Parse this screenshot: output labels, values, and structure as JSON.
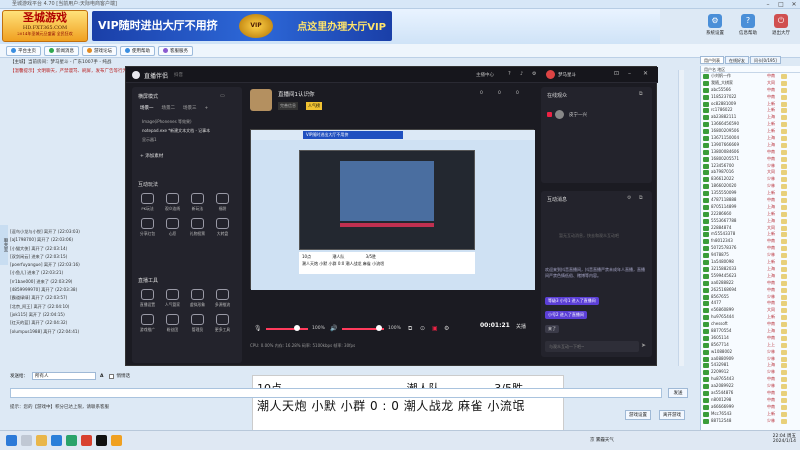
{
  "window": {
    "title": "圣城游戏平台 4.70 [当前用户:天际电商客户端]",
    "controls": [
      "–",
      "□",
      "✕"
    ]
  },
  "banner": {
    "logo_line1": "圣城游戏",
    "logo_line2": "HD.FXT365.COM",
    "logo_line3": "2014年圣城元旦盛宴 全民狂欢",
    "ad_left": "VIP随时进出大厅不用挤",
    "ad_badge": "VIP",
    "ad_right": "点这里办理大厅VIP",
    "buttons": [
      {
        "label": "系统设置",
        "icon": "gear-icon"
      },
      {
        "label": "信息帮助",
        "icon": "help-icon"
      },
      {
        "label": "官方通道",
        "icon": "home-icon"
      },
      {
        "label": "退出大厅",
        "icon": "logout-icon"
      }
    ]
  },
  "toolbar": {
    "buttons": [
      "平台主页",
      "新闻消息",
      "游戏论坛",
      "使用帮助",
      "客服服务"
    ],
    "right_buttons": [
      "用户列表",
      "在线好友"
    ]
  },
  "chat": {
    "header": "【主城】当前房间：梦马星斗 - 广东1007手 - 纯战",
    "notice": "【温馨提示】文明聊天，严禁谩骂、刷屏，发布广告等行为，违者将被封号处理。",
    "side_tab": "聊天室",
    "lines": [
      "[逗鸟小龙与小悦] 离开了 (22:03:03)",
      "[aJ1798700] 离开了 (22:03:06)",
      "[小猫大侠] 离开了 (22:03:14)",
      "[双剑闲云] 进来了 (22:03:15)",
      "[poerfuyangue] 离开了 (22:03:16)",
      "[小鱼儿] 进来了 (22:03:21)",
      "[rr1bae000] 进来了 (22:03:29)",
      "[4859999970] 离开了 (22:03:38)",
      "[霸道绿绿] 离开了 (22:03:57)",
      "[北京_阿王] 离开了 (22:04:10)",
      "[jok115] 离开了 (22:04:15)",
      "[红天的蓝] 离开了 (22:04:32)",
      "[olumpus1988] 离开了 (22:04:41)"
    ]
  },
  "userlist": {
    "tabs": [
      "用户列表",
      "在线好友",
      "问卡[0/195]"
    ],
    "header": "用户名         地区",
    "rows": [
      {
        "name": "小刘帆一作",
        "region": "中南"
      },
      {
        "name": "我随_大棋家",
        "region": "大同"
      },
      {
        "name": "abc55566",
        "region": "中南"
      },
      {
        "name": "1185237022",
        "region": "中南"
      },
      {
        "name": "oc82881009",
        "region": "上新"
      },
      {
        "name": "rc1786022",
        "region": "上新"
      },
      {
        "name": "ab23882111",
        "region": "上海"
      },
      {
        "name": "13666456590",
        "region": "上新"
      },
      {
        "name": "16800209506",
        "region": "上新"
      },
      {
        "name": "13671150004",
        "region": "上海"
      },
      {
        "name": "13907666669",
        "region": "上海"
      },
      {
        "name": "13800084606",
        "region": "中南"
      },
      {
        "name": "16800205571",
        "region": "中南"
      },
      {
        "name": "123456700",
        "region": "少林"
      },
      {
        "name": "ab7987016",
        "region": "大同"
      },
      {
        "name": "836612022",
        "region": "少林"
      },
      {
        "name": "1866020020",
        "region": "少林"
      },
      {
        "name": "1355550099",
        "region": "上新"
      },
      {
        "name": "4787118888",
        "region": "中南"
      },
      {
        "name": "8705114899",
        "region": "上海"
      },
      {
        "name": "22286660",
        "region": "上新"
      },
      {
        "name": "5553667788",
        "region": "上海"
      },
      {
        "name": "22884874",
        "region": "大同"
      },
      {
        "name": "m55543378",
        "region": "上新"
      },
      {
        "name": "fn8012343",
        "region": "中南"
      },
      {
        "name": "5072578376",
        "region": "中南"
      },
      {
        "name": "9478875",
        "region": "少林"
      },
      {
        "name": "1a5480098",
        "region": "上新"
      },
      {
        "name": "3215882033",
        "region": "上海"
      },
      {
        "name": "5599445623",
        "region": "上海"
      },
      {
        "name": "aa0288822",
        "region": "中南"
      },
      {
        "name": "2625168694",
        "region": "中南"
      },
      {
        "name": "8567655",
        "region": "少林"
      },
      {
        "name": "4477",
        "region": "中南"
      },
      {
        "name": "e56860899",
        "region": "大同"
      },
      {
        "name": "hu9765444",
        "region": "上新"
      },
      {
        "name": "chessoft",
        "region": "中南"
      },
      {
        "name": "88770554",
        "region": "上海"
      },
      {
        "name": "3605114",
        "region": "中南"
      },
      {
        "name": "8567714",
        "region": "上上"
      },
      {
        "name": "w1088002",
        "region": "少林"
      },
      {
        "name": "aa0880909",
        "region": "少林"
      },
      {
        "name": "5432981",
        "region": "上海"
      },
      {
        "name": "2209912",
        "region": "少林"
      },
      {
        "name": "hu8765443",
        "region": "中南"
      },
      {
        "name": "aa2089922",
        "region": "少林"
      },
      {
        "name": "as5544876",
        "region": "中南"
      },
      {
        "name": "n8001298",
        "region": "中南"
      },
      {
        "name": "a66666999",
        "region": "中南"
      },
      {
        "name": "Mcc76543",
        "region": "上新"
      },
      {
        "name": "88712548",
        "region": "少林"
      }
    ]
  },
  "obs": {
    "app_name": "直播伴侣",
    "app_sub": "抖音",
    "title_right": [
      "主播中心",
      "?",
      "♪",
      "⚙"
    ],
    "user": "梦马星斗",
    "mode_label": "横屏模式",
    "scene_tabs": [
      "场景一",
      "场景二",
      "场景三"
    ],
    "sources": [
      "Image(iPhonenes 等效果)",
      "notepad.exe *新建文本文档 - 记事本",
      "显示器1"
    ],
    "add_source": "+ 添加素材",
    "interaction_label": "互动玩法",
    "interaction_icons": [
      "PK玩法",
      "观众连线",
      "新玩法",
      "福袋",
      "分享红包",
      "心愿",
      "礼物投票",
      "大转盘"
    ],
    "live_tools_label": "直播工具",
    "live_tools_icons": [
      "直播设置",
      "人气管家",
      "虚拟形象",
      "多源推流",
      "游戏推广",
      "粉丝团",
      "管理员",
      "更多工具"
    ],
    "live_title": "直播间1认识你",
    "live_tags": [
      "完善信息",
      "人气榜"
    ],
    "live_stats": [
      "0",
      "0",
      "0"
    ],
    "preview_banner": "VIP随时进出大厅不用挤",
    "preview_mini": [
      "10点",
      "潮人队",
      "3/5胜",
      "潮人天炮 小默 小群 0:0 潮人战龙 麻雀 小流氓"
    ],
    "mic_label": "100%",
    "speaker_label": "100%",
    "timer": "00:01:21",
    "stop_label": "关播",
    "status": "CPU: 0.00%   内存: 16.28%   码率: 5100kbps   帧率: 30fps",
    "online_title": "在线观众",
    "online_user": "皮宁一兴",
    "messages_title": "互动消息",
    "messages_hint": "暂无互动消息，快去和观众互动吧",
    "system_msg": "欢迎来到抖音直播间，抖音直播严禁未成年人直播，直播间严禁色情低俗、赌博等内容。",
    "msg_chip1": "等级3 小号1 进入了直播间",
    "msg_chip2": "小号2 进入了直播间",
    "msg_chip3": "来了",
    "input_placeholder": "与观众互动一下吧~"
  },
  "overlay": {
    "hour": "10点",
    "team": "潮人队",
    "record": "3/5胜",
    "score_line": "潮人天炮  小默  小群    0  :  0    潮人战龙  麻雀  小流氓"
  },
  "input": {
    "label": "发送给：",
    "select": "所有人",
    "private_label": "悄悄话",
    "send_label": "发送",
    "bottom_info": "提示：您的【游戏中】积分已达上限，请联系客服",
    "buttons": [
      "游戏设置",
      "离开游戏"
    ]
  },
  "taskbar": {
    "time": "22:04  周五",
    "date": "2024/1/14",
    "tray_label": "英 ⌃ 网络",
    "weather": "京 雾霾天气"
  }
}
